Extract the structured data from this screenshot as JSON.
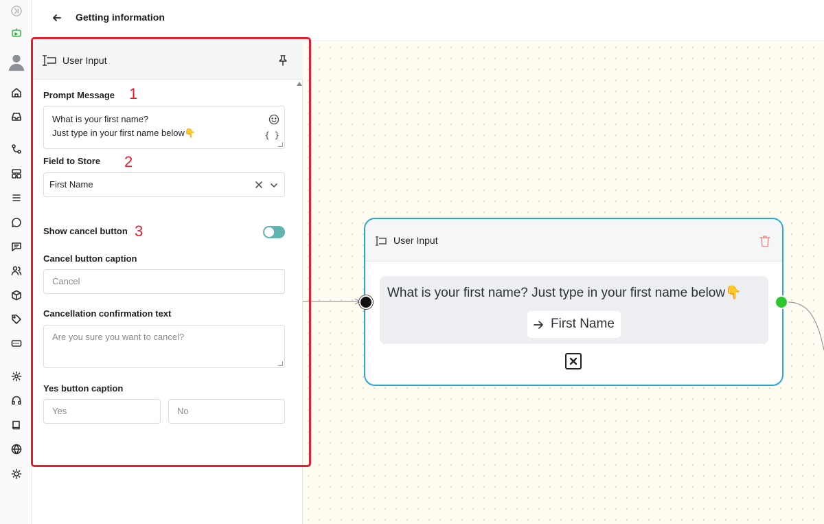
{
  "header": {
    "title": "Getting information"
  },
  "panel": {
    "title": "User Input",
    "prompt": {
      "label": "Prompt Message",
      "marker": "1",
      "text": "What is your first name?\nJust type in your first name below👇"
    },
    "field_to_store": {
      "label": "Field to Store",
      "marker": "2",
      "value": "First Name"
    },
    "show_cancel": {
      "label": "Show cancel button",
      "marker": "3",
      "enabled": true
    },
    "cancel_caption": {
      "label": "Cancel button caption",
      "placeholder": "Cancel"
    },
    "cancel_confirm": {
      "label": "Cancellation confirmation text",
      "placeholder": "Are you sure you want to cancel?"
    },
    "yes_caption": {
      "label": "Yes button caption",
      "yes_placeholder": "Yes",
      "no_placeholder": "No"
    }
  },
  "node": {
    "title": "User Input",
    "message": "What is your first name? Just type in your first name below👇",
    "field": "First Name"
  },
  "colors": {
    "highlight": "#e11d2e",
    "node_border": "#2ba7d3",
    "toggle_on": "#5fb3b0",
    "port_out": "#2ec52e",
    "canvas_bg": "#fffdf2"
  },
  "rail_icons": [
    "collapse-icon",
    "bot-icon",
    "avatar",
    "home-icon",
    "inbox-icon",
    "flow-icon",
    "layout-icon",
    "list-icon",
    "chat-icon",
    "message-icon",
    "users-icon",
    "box-icon",
    "tag-icon",
    "keyboard-icon",
    "settings-icon",
    "headset-icon",
    "book-icon",
    "globe-icon",
    "sun-icon"
  ]
}
